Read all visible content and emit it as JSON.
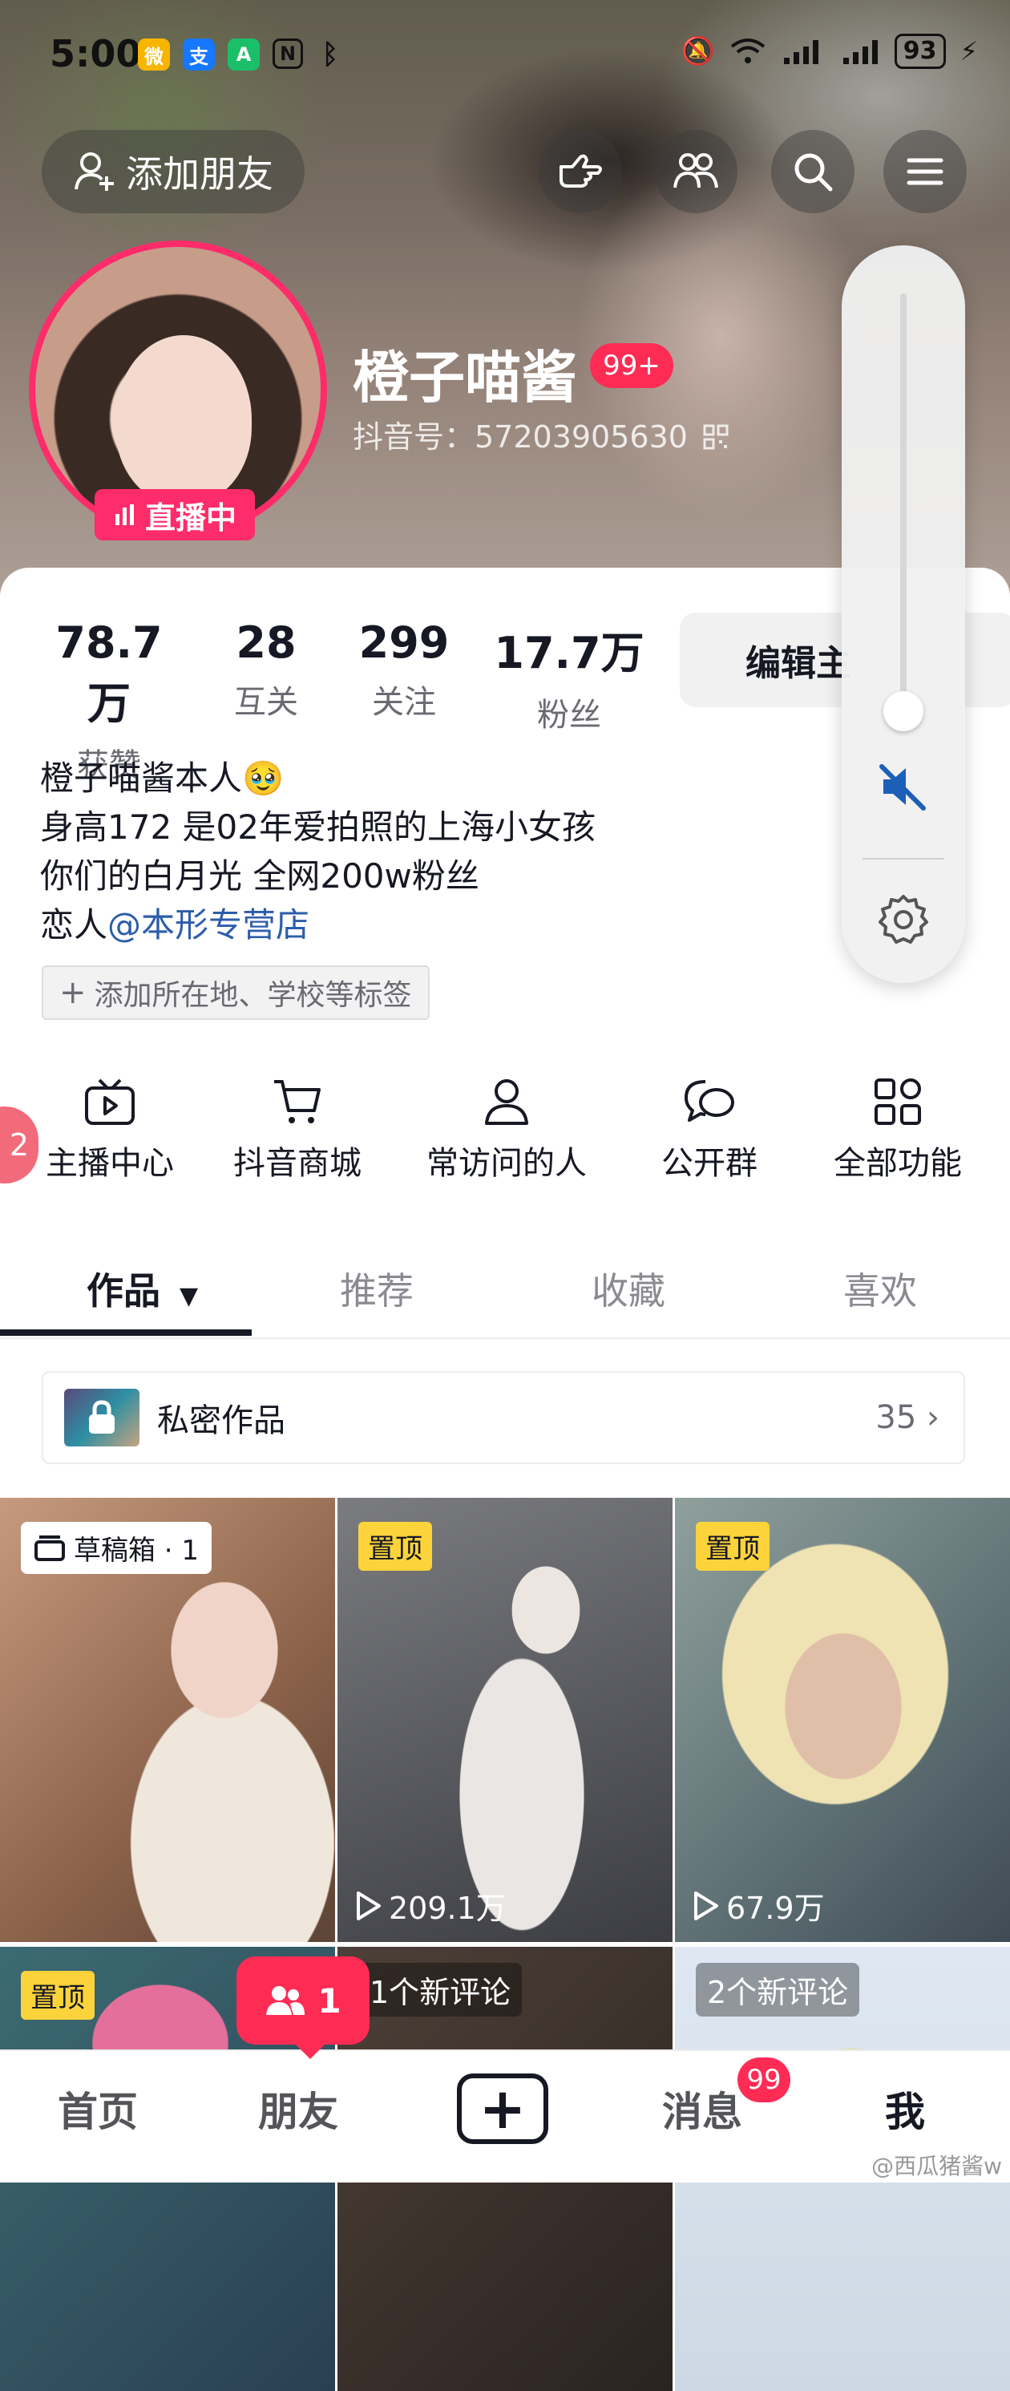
{
  "status_bar": {
    "time": "5:00",
    "battery": "93"
  },
  "header": {
    "add_friend_label": "添加朋友"
  },
  "profile": {
    "name": "橙子喵酱",
    "name_badge": "99+",
    "douyin_id": "抖音号：57203905630",
    "live_label": "直播中"
  },
  "stats": [
    {
      "value": "78.7万",
      "label": "获赞"
    },
    {
      "value": "28",
      "label": "互关"
    },
    {
      "value": "299",
      "label": "关注"
    },
    {
      "value": "17.7万",
      "label": "粉丝"
    }
  ],
  "edit_button": "编辑主",
  "bio": {
    "line1": "橙子喵酱本人🥹",
    "line2": "身高172 是02年爱拍照的上海小女孩",
    "line3": "你们的白月光 全网200w粉丝",
    "line4_prefix": "恋人",
    "line4_mention": "@本形专营店"
  },
  "tag_chip": "添加所在地、学校等标签",
  "side_tab": "2",
  "functions": [
    {
      "label": "主播中心",
      "icon": "tv-icon"
    },
    {
      "label": "抖音商城",
      "icon": "cart-icon"
    },
    {
      "label": "常访问的人",
      "icon": "person-icon"
    },
    {
      "label": "公开群",
      "icon": "chat-bubbles-icon"
    },
    {
      "label": "全部功能",
      "icon": "grid-apps-icon"
    }
  ],
  "tabs": [
    {
      "label": "作品"
    },
    {
      "label": "推荐"
    },
    {
      "label": "收藏"
    },
    {
      "label": "喜欢"
    }
  ],
  "private_works": {
    "label": "私密作品",
    "count": "35"
  },
  "videos": [
    {
      "tag": "草稿箱 · 1",
      "plays": ""
    },
    {
      "tag": "置顶",
      "plays": "209.1万"
    },
    {
      "tag": "置顶",
      "plays": "67.9万"
    },
    {
      "tag": "置顶",
      "plays": ""
    },
    {
      "tag": "1个新评论",
      "plays": ""
    },
    {
      "tag": "2个新评论",
      "plays": ""
    }
  ],
  "friend_popup": "1",
  "bottom_nav": [
    {
      "label": "首页"
    },
    {
      "label": "朋友"
    },
    {
      "label": "消息",
      "badge": "99"
    },
    {
      "label": "我"
    }
  ],
  "watermark": "@西瓜猪酱w",
  "colors": {
    "accent": "#fe2c55",
    "pin": "#fcd33a",
    "mention": "#2c5dab"
  }
}
